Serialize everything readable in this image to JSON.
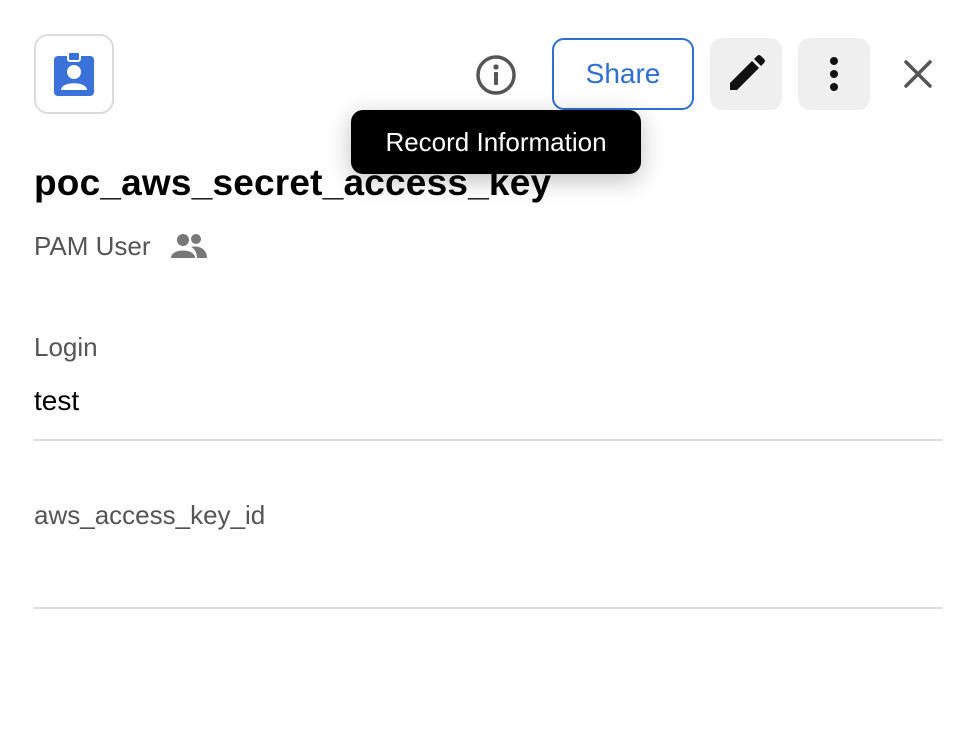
{
  "header": {
    "share_label": "Share",
    "tooltip": "Record Information"
  },
  "record": {
    "title": "poc_aws_secret_access_key",
    "type": "PAM User"
  },
  "fields": [
    {
      "label": "Login",
      "value": "test"
    },
    {
      "label": "aws_access_key_id",
      "value": ""
    }
  ],
  "colors": {
    "accent": "#2f6fd1",
    "icon_blue": "#3a72d9",
    "muted_icon": "#777777"
  }
}
